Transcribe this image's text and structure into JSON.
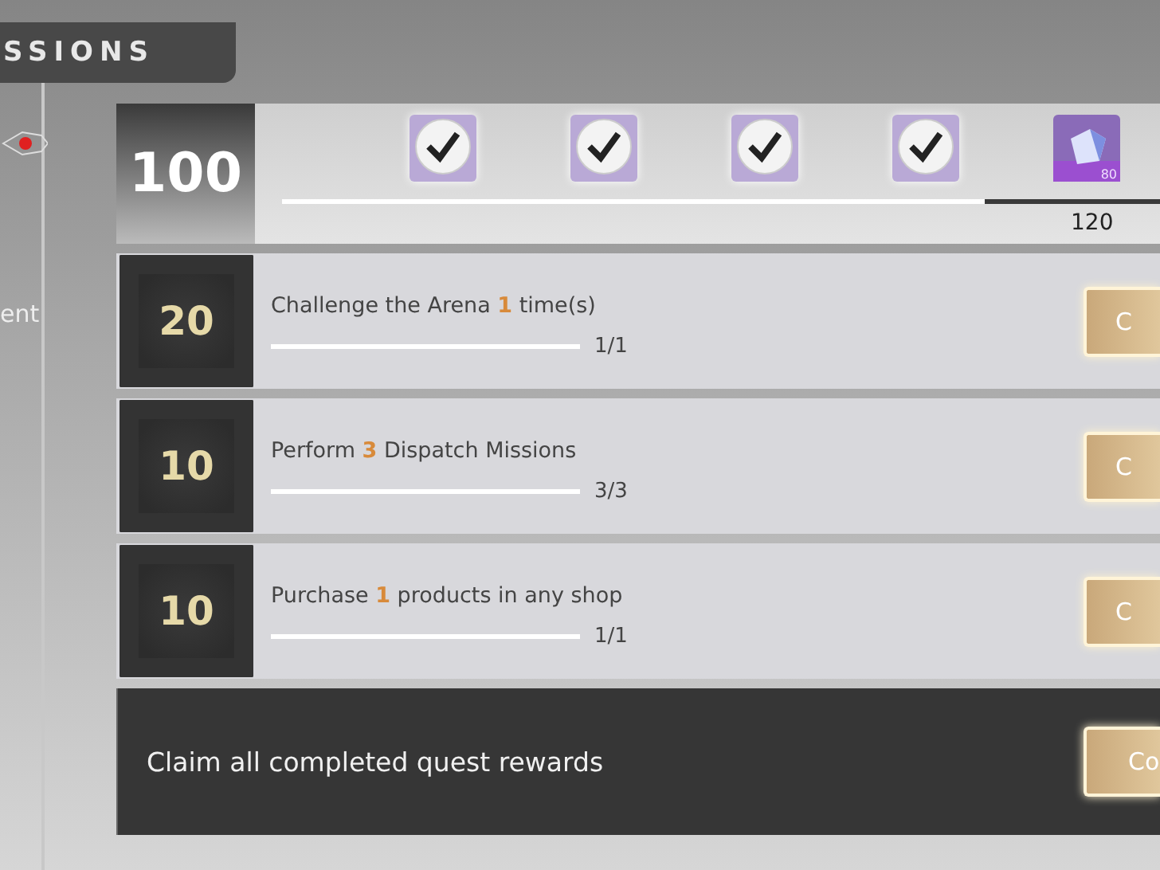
{
  "header": {
    "title": "SSIONS"
  },
  "sidebar": {
    "label": "ent"
  },
  "milestones": {
    "score": "100",
    "level": 0.8,
    "end_label": "120",
    "rewards": [
      {
        "kind": "check",
        "claimed": true
      },
      {
        "kind": "check",
        "claimed": true
      },
      {
        "kind": "check",
        "claimed": true
      },
      {
        "kind": "check",
        "claimed": true
      },
      {
        "kind": "gem",
        "claimed": false,
        "amount": "80"
      }
    ]
  },
  "quests": [
    {
      "reward": "20",
      "title": "Challenge the Arena **1** time(s)",
      "level": 1,
      "count": "1/1",
      "button": "C"
    },
    {
      "reward": "10",
      "title": "Perform **3** Dispatch Missions",
      "level": 1,
      "count": "3/3",
      "button": "C"
    },
    {
      "reward": "10",
      "title": "Purchase **1** products in any shop",
      "level": 1,
      "count": "1/1",
      "button": "C"
    }
  ],
  "claim_all": {
    "text": "Claim all completed quest rewards",
    "button": "Co"
  }
}
